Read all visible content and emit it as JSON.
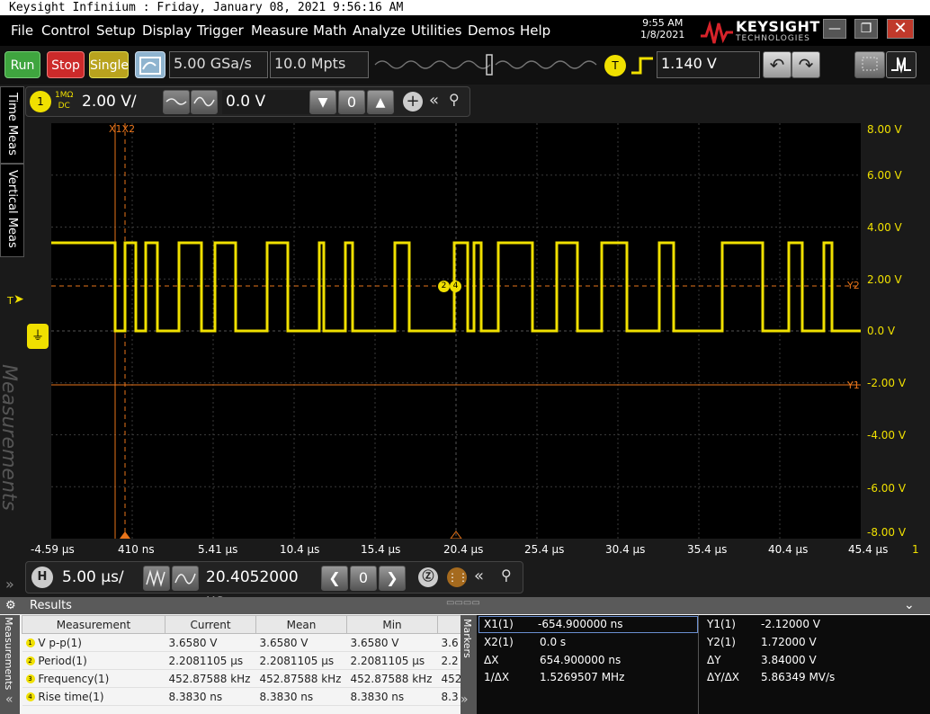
{
  "window": {
    "title": "Keysight Infiniium : Friday, January 08, 2021 9:56:16 AM"
  },
  "menu": [
    "File",
    "Control",
    "Setup",
    "Display",
    "Trigger",
    "Measure",
    "Math",
    "Analyze",
    "Utilities",
    "Demos",
    "Help"
  ],
  "clock": {
    "time": "9:55 AM",
    "date": "1/8/2021"
  },
  "brand": {
    "name": "KEYSIGHT",
    "sub": "TECHNOLOGIES"
  },
  "toolbar": {
    "run": "Run",
    "stop": "Stop",
    "single": "Single",
    "sample_rate": "5.00 GSa/s",
    "memory_depth": "10.0 Mpts",
    "trigger_badge": "T",
    "trigger_level": "1.140 V"
  },
  "channel": {
    "number": "1",
    "coupling_top": "1MΩ",
    "coupling_bottom": "DC",
    "scale": "2.00 V/",
    "offset": "0.0 V"
  },
  "side_tabs": {
    "time": "Time Meas",
    "vertical": "Vertical Meas",
    "measurements": "Measurements"
  },
  "scope": {
    "y_labels": [
      "8.00 V",
      "6.00 V",
      "4.00 V",
      "2.00 V",
      "0.0 V",
      "-2.00 V",
      "-4.00 V",
      "-6.00 V",
      "-8.00 V"
    ],
    "x_labels": [
      "-4.59 µs",
      "410 ns",
      "5.41 µs",
      "10.4 µs",
      "15.4 µs",
      "20.4 µs",
      "25.4 µs",
      "30.4 µs",
      "35.4 µs",
      "40.4 µs",
      "45.4 µs"
    ],
    "x_suffix": "1",
    "marker_x_label": "X1X2",
    "y1_label": "Y1",
    "y2_label": "Y2",
    "trigger_marker": "T",
    "mk2": "2",
    "mk4": "4"
  },
  "horizontal": {
    "badge": "H",
    "scale": "5.00 µs/",
    "position": "20.4052000 µs"
  },
  "results": {
    "title": "Results",
    "side_label": "Measurements",
    "markers_label": "Markers",
    "headers": [
      "Measurement",
      "Current",
      "Mean",
      "Min",
      ""
    ],
    "rows": [
      {
        "n": "1",
        "name": "V p-p(1)",
        "current": "3.6580 V",
        "mean": "3.6580 V",
        "min": "3.6580 V",
        "max": "3.6"
      },
      {
        "n": "2",
        "name": "Period(1)",
        "current": "2.2081105 µs",
        "mean": "2.2081105 µs",
        "min": "2.2081105 µs",
        "max": "2.2"
      },
      {
        "n": "3",
        "name": "Frequency(1)",
        "current": "452.87588 kHz",
        "mean": "452.87588 kHz",
        "min": "452.87588 kHz",
        "max": "452"
      },
      {
        "n": "4",
        "name": "Rise time(1)",
        "current": "8.3830 ns",
        "mean": "8.3830 ns",
        "min": "8.3830 ns",
        "max": "8.3"
      }
    ]
  },
  "markers": {
    "x1_label": "X1(1)",
    "x1_value": "-654.900000 ns",
    "x2_label": "X2(1)",
    "x2_value": "0.0 s",
    "dx_label": "ΔX",
    "dx_value": "654.900000 ns",
    "inv_dx_label": "1/ΔX",
    "inv_dx_value": "1.5269507 MHz",
    "y1_label": "Y1(1)",
    "y1_value": "-2.12000 V",
    "y2_label": "Y2(1)",
    "y2_value": "1.72000 V",
    "dy_label": "ΔY",
    "dy_value": "3.84000 V",
    "dydx_label": "ΔY/ΔX",
    "dydx_value": "5.86349 MV/s"
  },
  "colors": {
    "trace": "#f0e000",
    "marker": "#e8741a",
    "grid": "#3a3a3a",
    "run": "#3fa53f",
    "stop": "#cc2a2a",
    "single": "#b9a31e"
  }
}
